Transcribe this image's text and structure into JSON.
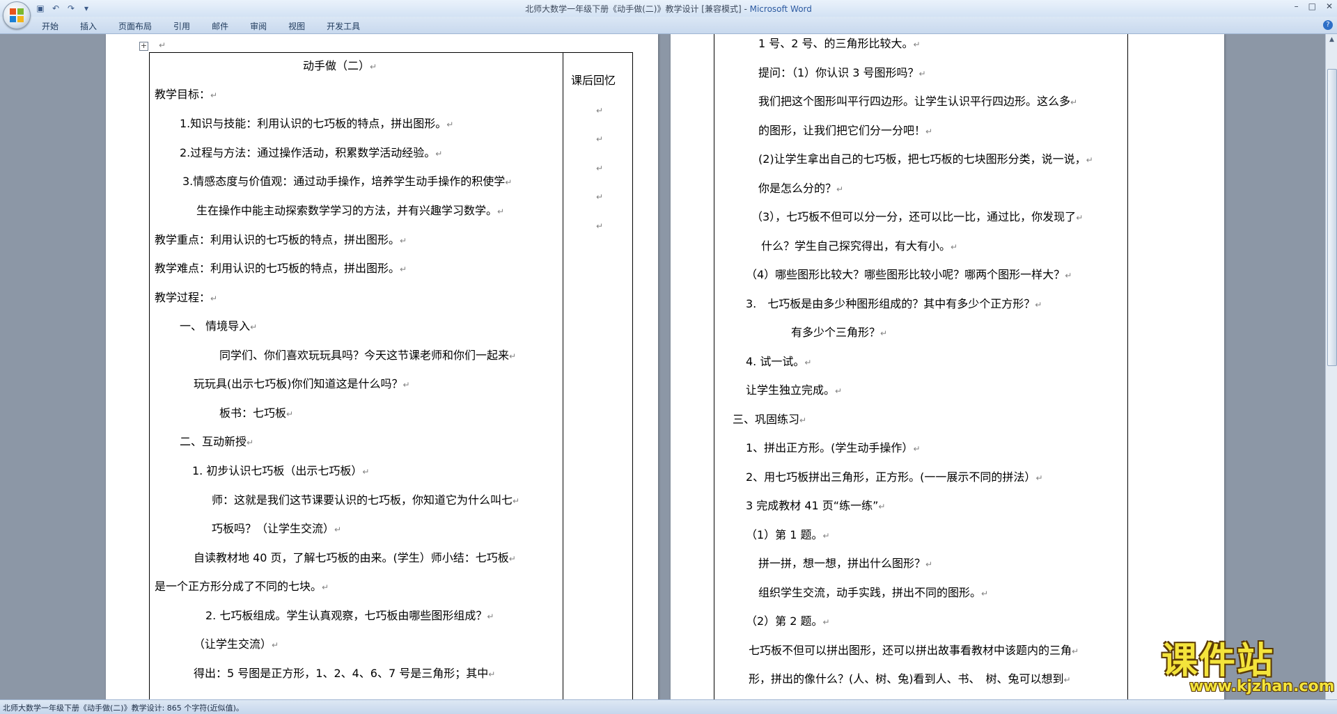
{
  "window": {
    "title_doc": "北师大数学一年级下册《动手做(二)》教学设计 [兼容模式] - ",
    "title_app": "Microsoft Word",
    "controls": [
      "–",
      "□",
      "✕"
    ]
  },
  "quick_access": {
    "icons": [
      "save-icon",
      "undo-icon",
      "redo-icon",
      "customize-icon"
    ],
    "glyphs": [
      "▣",
      "↶",
      "↷",
      "▾"
    ]
  },
  "ribbon": {
    "tabs": [
      "开始",
      "插入",
      "页面布局",
      "引用",
      "邮件",
      "审阅",
      "视图",
      "开发工具"
    ],
    "help": "?"
  },
  "document": {
    "table_move_handle": "+",
    "cursor_mark": "↵",
    "left_page": {
      "lines": [
        "动手做（二）",
        "教学目标：",
        "1.知识与技能：利用认识的七巧板的特点，拼出图形。",
        "2.过程与方法：通过操作活动，积累数学活动经验。",
        "3.情感态度与价值观：通过动手操作，培养学生动手操作的积使学",
        "生在操作中能主动探索数学学习的方法，并有兴趣学习数学。",
        "教学重点：利用认识的七巧板的特点，拼出图形。",
        "教学难点：利用认识的七巧板的特点，拼出图形。",
        "教学过程：",
        "一、 情境导入",
        "同学们、你们喜欢玩玩具吗？今天这节课老师和你们一起来",
        "玩玩具(出示七巧板)你们知道这是什么吗？",
        "板书：七巧板",
        "二、互动新授",
        "1. 初步认识七巧板（出示七巧板）",
        "师：这就是我们这节课要认识的七巧板，你知道它为什么叫七",
        "巧板吗？（让学生交流）",
        "自读教材地 40 页，了解七巧板的由来。(学生）师小结：七巧板",
        "是一个正方形分成了不同的七块。",
        "2. 七巧板组成。学生认真观察，七巧板由哪些图形组成？",
        "（让学生交流）",
        "得出：5 号图是正方形，1、2、4、6、7 号是三角形；其中"
      ],
      "side_header": "课后回忆"
    },
    "right_page": {
      "lines": [
        "1 号、2 号、的三角形比较大。",
        "提问：（1）你认识 3 号图形吗？",
        "我们把这个图形叫平行四边形。让学生认识平行四边形。这么多",
        "的图形，让我们把它们分一分吧！",
        "(2)让学生拿出自己的七巧板，把七巧板的七块图形分类，说一说，",
        "你是怎么分的？",
        "（3），七巧板不但可以分一分，还可以比一比，通过比，你发现了",
        "什么？学生自己探究得出，有大有小。",
        "（4）哪些图形比较大？哪些图形比较小呢？哪两个图形一样大？",
        "3.　七巧板是由多少种图形组成的？其中有多少个正方形？",
        "有多少个三角形？",
        "4. 试一试。",
        "让学生独立完成。",
        "三、巩固练习",
        "1、拼出正方形。(学生动手操作）",
        "2、用七巧板拼出三角形，正方形。(一一展示不同的拼法）",
        "3 完成教材 41 页“练一练”",
        "（1）第 1 题。",
        "拼一拼，想一想，拼出什么图形？",
        "组织学生交流，动手实践，拼出不同的图形。",
        "（2）第 2 题。",
        "七巧板不但可以拼出图形，还可以拼出故事看教材中该题内的三角",
        "形，拼出的像什么？(人、树、兔)看到人、书、　树、兔可以想到"
      ]
    }
  },
  "scrollbar": {
    "up": "▲",
    "down": "▼"
  },
  "status_bar": {
    "text": "北师大数学一年级下册《动手做(二)》教学设计: 865 个字符(近似值)。"
  },
  "watermark": {
    "text": "课件站",
    "url": "www.kjzhan.com"
  }
}
